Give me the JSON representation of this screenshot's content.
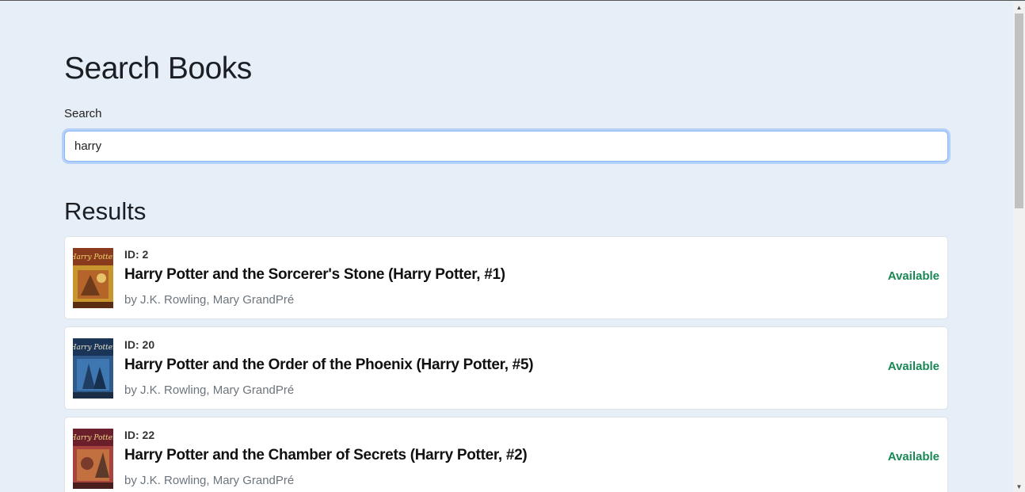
{
  "page": {
    "title": "Search Books",
    "search_label": "Search",
    "search_value": "harry",
    "results_heading": "Results"
  },
  "results": [
    {
      "id_text": "ID: 2",
      "title": "Harry Potter and the Sorcerer's Stone (Harry Potter, #1)",
      "author": "by J.K. Rowling, Mary GrandPré",
      "status": "Available",
      "cover_color": "#c8962e"
    },
    {
      "id_text": "ID: 20",
      "title": "Harry Potter and the Order of the Phoenix (Harry Potter, #5)",
      "author": "by J.K. Rowling, Mary GrandPré",
      "status": "Available",
      "cover_color": "#2e5a8c"
    },
    {
      "id_text": "ID: 22",
      "title": "Harry Potter and the Chamber of Secrets (Harry Potter, #2)",
      "author": "by J.K. Rowling, Mary GrandPré",
      "status": "Available",
      "cover_color": "#a8433e"
    }
  ],
  "colors": {
    "background": "#e6eef7",
    "available": "#198754",
    "focus_border": "#86b7fe"
  },
  "icons": {
    "scroll_up": "scroll-up-arrow-icon",
    "scroll_down": "scroll-down-arrow-icon"
  }
}
